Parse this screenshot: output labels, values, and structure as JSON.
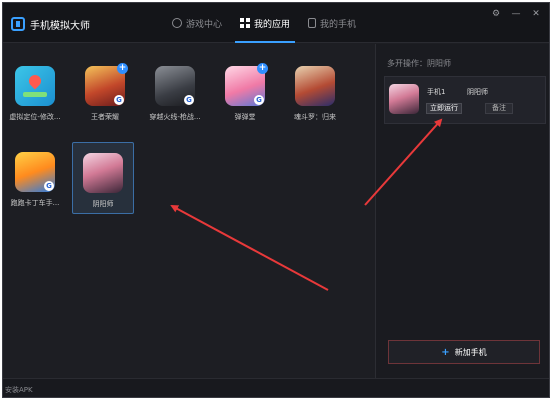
{
  "window": {
    "title": "手机模拟大师"
  },
  "nav": {
    "tabs": [
      {
        "label": "游戏中心",
        "icon": "gamepad-icon",
        "active": false
      },
      {
        "label": "我的应用",
        "icon": "grid-icon",
        "active": true
      },
      {
        "label": "我的手机",
        "icon": "phone-icon",
        "active": false
      }
    ]
  },
  "window_controls": {
    "settings": "⚙",
    "minimize": "—",
    "close": "✕"
  },
  "apps": [
    {
      "label": "虚拟定位-修改...",
      "icon": "location-app-icon",
      "badge": ""
    },
    {
      "label": "王者荣耀",
      "icon": "wzry-app-icon",
      "badge": "+"
    },
    {
      "label": "穿越火线-枪战...",
      "icon": "cf-app-icon",
      "badge": ""
    },
    {
      "label": "弹弹堂",
      "icon": "ddt-app-icon",
      "badge": "+"
    },
    {
      "label": "魂斗罗：归来",
      "icon": "contra-app-icon",
      "badge": ""
    },
    {
      "label": "跑跑卡丁车手...",
      "icon": "kart-app-icon",
      "badge": ""
    },
    {
      "label": "阴阳师",
      "icon": "onmyoji-app-icon",
      "badge": "",
      "selected": true
    }
  ],
  "side": {
    "title": "多开操作：阴阳师",
    "phone": {
      "name": "手机1",
      "app": "阴阳师",
      "run_label": "立即运行",
      "note_label": "备注"
    },
    "add_phone_label": "新加手机",
    "add_phone_plus": "+"
  },
  "footer": {
    "install_label": "安装APK"
  },
  "colors": {
    "accent": "#3aa0ff",
    "arrow": "#e8393a",
    "background": "#1d1e23"
  }
}
